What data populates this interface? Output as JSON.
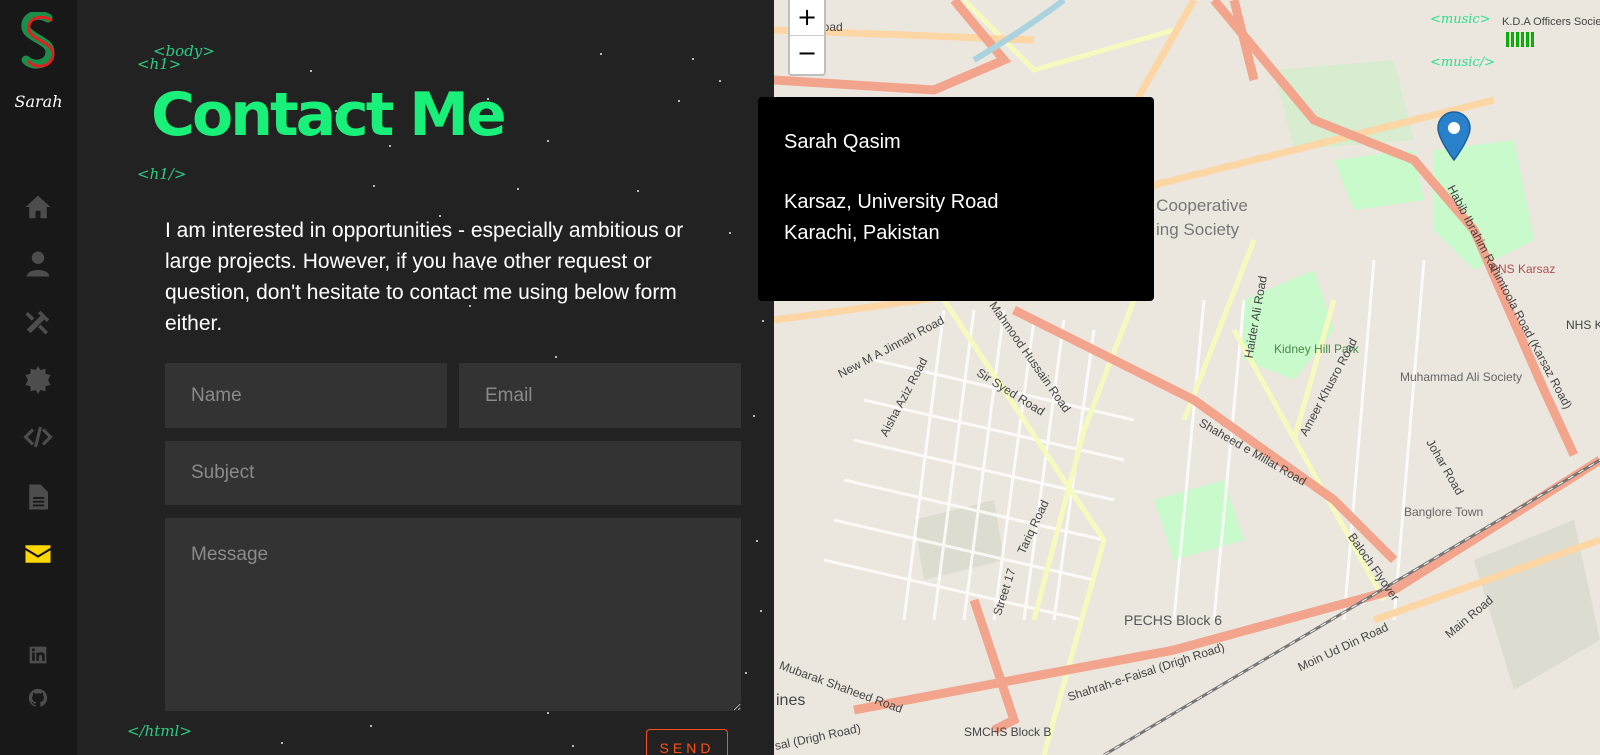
{
  "sidebar": {
    "logo_letter": "S",
    "logo_subtitle": "Sarah",
    "nav": [
      {
        "name": "home-icon"
      },
      {
        "name": "user-icon"
      },
      {
        "name": "tools-icon"
      },
      {
        "name": "gear-icon"
      },
      {
        "name": "code-icon"
      },
      {
        "name": "document-icon"
      },
      {
        "name": "envelope-icon",
        "active": true
      }
    ],
    "social": [
      {
        "name": "linkedin-icon"
      },
      {
        "name": "github-icon"
      }
    ]
  },
  "tags": {
    "body_open": "<body>",
    "h1_open": "<h1>",
    "h1_close": "<h1/>",
    "html_close": "</html>",
    "music_open": "<music>",
    "music_close": "<music/>"
  },
  "contact": {
    "title": "Contact Me",
    "intro": "I am interested in opportunities - especially ambitious or large projects. However, if you have other request or question, don't hesitate to contact me using below form either.",
    "form": {
      "name_placeholder": "Name",
      "email_placeholder": "Email",
      "subject_placeholder": "Subject",
      "message_placeholder": "Message",
      "send_label": "SEND"
    }
  },
  "map": {
    "zoom_in": "+",
    "zoom_out": "−",
    "popup": {
      "name": "Sarah Qasim",
      "line1": "Karsaz, University Road",
      "line2": "Karachi, Pakistan"
    },
    "labels": {
      "road1": "Road",
      "cooperative": "d Cooperative",
      "society": "ing Society",
      "jinnah_road": "New M A Jinnah Road",
      "sir_syed": "Sir Syed Road",
      "millat": "Shaheed e Millat Road",
      "kidney": "Kidney Hill Park",
      "muhammad_ali": "Muhammad Ali Society",
      "pns": "PNS Karsaz",
      "bangalore": "Banglore Town",
      "pechs": "PECHS Block 6",
      "faisal": "Shahrah-e-Faisal (Drigh Road)",
      "moin": "Moin Ud Din Road",
      "main": "Main Road",
      "tariq": "Tariq Road",
      "haider": "Haider Ali Road",
      "smchs": "SMCHS Block B",
      "ines": "ines",
      "habib": "Habib Ibrahim Rahimtoola Road (Karsaz Road)",
      "kda": "K.D.A Officers Society",
      "ameer": "Ameer Khusro Road",
      "johar": "Johar Road",
      "mubarak": "Mubarak Shaheed Road",
      "street": "Street 17",
      "aisha": "Aisha Aziz Road",
      "mahmood": "Mahmood Hussain Road",
      "baloch": "Baloch Flyover",
      "sal": "sal (Drigh Road)",
      "nhs": "NHS K"
    },
    "colors": {
      "trunk": "#f2a48c",
      "primary": "#fcd6a4",
      "secondary": "#f7fabf",
      "park": "#c8facc",
      "marker": "#2a81cb"
    }
  }
}
